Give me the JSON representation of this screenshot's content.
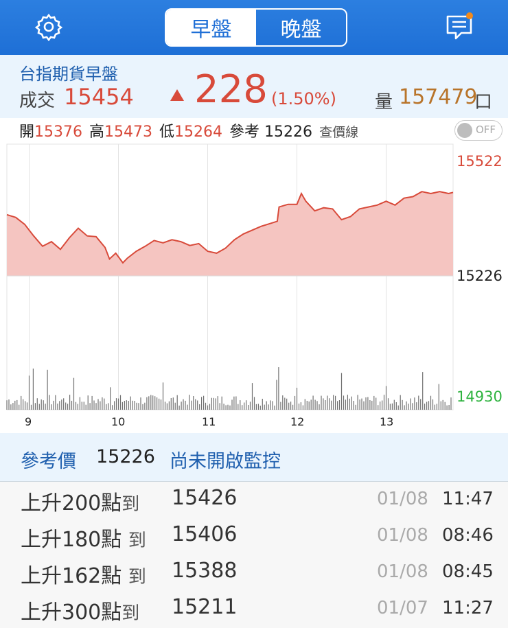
{
  "header": {
    "tabs": [
      {
        "label": "早盤",
        "active": true
      },
      {
        "label": "晚盤",
        "active": false
      }
    ],
    "colors": {
      "bar": "#1f6fd6",
      "notification_dot": "#f28a1c"
    },
    "icons": {
      "left": "gear-icon",
      "right": "message-icon"
    }
  },
  "quote": {
    "title": "台指期貨早盤",
    "trade_label": "成交",
    "price": "15454",
    "change": "228",
    "change_pct": "(1.50%)",
    "volume_label": "量",
    "volume": "157479",
    "volume_unit": "口",
    "direction": "up"
  },
  "ohlc": {
    "open_label": "開",
    "open": "15376",
    "high_label": "高",
    "high": "15473",
    "low_label": "低",
    "low": "15264",
    "ref_label": "參考",
    "ref": "15226",
    "line_label": "查價線",
    "toggle": "OFF"
  },
  "chart_data": {
    "type": "area",
    "x_ticks": [
      "9",
      "10",
      "11",
      "12",
      "13"
    ],
    "y_labels": {
      "top": "15522",
      "mid": "15226",
      "bottom": "14930"
    },
    "ylim": [
      14930,
      15522
    ],
    "reference": 15226,
    "x_range": [
      8.75,
      13.75
    ],
    "price_series": [
      [
        8.75,
        15385
      ],
      [
        8.85,
        15378
      ],
      [
        8.95,
        15360
      ],
      [
        9.05,
        15330
      ],
      [
        9.15,
        15303
      ],
      [
        9.25,
        15315
      ],
      [
        9.35,
        15295
      ],
      [
        9.45,
        15325
      ],
      [
        9.55,
        15350
      ],
      [
        9.65,
        15330
      ],
      [
        9.75,
        15328
      ],
      [
        9.85,
        15300
      ],
      [
        9.9,
        15270
      ],
      [
        9.97,
        15285
      ],
      [
        10.05,
        15260
      ],
      [
        10.1,
        15272
      ],
      [
        10.2,
        15290
      ],
      [
        10.3,
        15303
      ],
      [
        10.4,
        15318
      ],
      [
        10.5,
        15312
      ],
      [
        10.6,
        15320
      ],
      [
        10.7,
        15315
      ],
      [
        10.8,
        15305
      ],
      [
        10.9,
        15310
      ],
      [
        11.0,
        15290
      ],
      [
        11.1,
        15285
      ],
      [
        11.2,
        15298
      ],
      [
        11.3,
        15320
      ],
      [
        11.4,
        15335
      ],
      [
        11.5,
        15345
      ],
      [
        11.6,
        15355
      ],
      [
        11.7,
        15362
      ],
      [
        11.78,
        15368
      ],
      [
        11.8,
        15405
      ],
      [
        11.9,
        15412
      ],
      [
        12.0,
        15412
      ],
      [
        12.05,
        15440
      ],
      [
        12.1,
        15420
      ],
      [
        12.2,
        15395
      ],
      [
        12.3,
        15403
      ],
      [
        12.4,
        15400
      ],
      [
        12.5,
        15372
      ],
      [
        12.6,
        15380
      ],
      [
        12.7,
        15400
      ],
      [
        12.8,
        15405
      ],
      [
        12.9,
        15410
      ],
      [
        13.0,
        15420
      ],
      [
        13.1,
        15410
      ],
      [
        13.2,
        15428
      ],
      [
        13.3,
        15432
      ],
      [
        13.4,
        15445
      ],
      [
        13.5,
        15440
      ],
      [
        13.6,
        15445
      ],
      [
        13.7,
        15440
      ],
      [
        13.75,
        15443
      ]
    ],
    "volume_spikes": [
      9.0,
      9.2,
      9.5,
      9.9,
      10.5,
      11.5,
      11.78,
      12.0,
      12.5,
      13.0,
      13.4,
      13.6
    ],
    "colors": {
      "line": "#d84a3a",
      "fill": "#f5c5c1",
      "volume": "#707070",
      "grid": "#e3e3e3",
      "ylab_top": "#d84a3a",
      "ylab_mid": "#222222",
      "ylab_bottom": "#2fb340"
    }
  },
  "monitor": {
    "ref_label": "參考價",
    "ref_value": "15226",
    "status": "尚未開啟監控"
  },
  "alerts": [
    {
      "prefix": "上升",
      "points": "200",
      "suffix": "點",
      "to": "到",
      "price": "15426",
      "date": "01/08",
      "time": "11:47"
    },
    {
      "prefix": "上升",
      "points": "180",
      "suffix": "點",
      "to": "到",
      "price": "15406",
      "date": "01/08",
      "time": "08:46"
    },
    {
      "prefix": "上升",
      "points": "162",
      "suffix": "點",
      "to": "到",
      "price": "15388",
      "date": "01/08",
      "time": "08:45"
    },
    {
      "prefix": "上升",
      "points": "300",
      "suffix": "點",
      "to": "到",
      "price": "15211",
      "date": "01/07",
      "time": "11:27"
    }
  ]
}
